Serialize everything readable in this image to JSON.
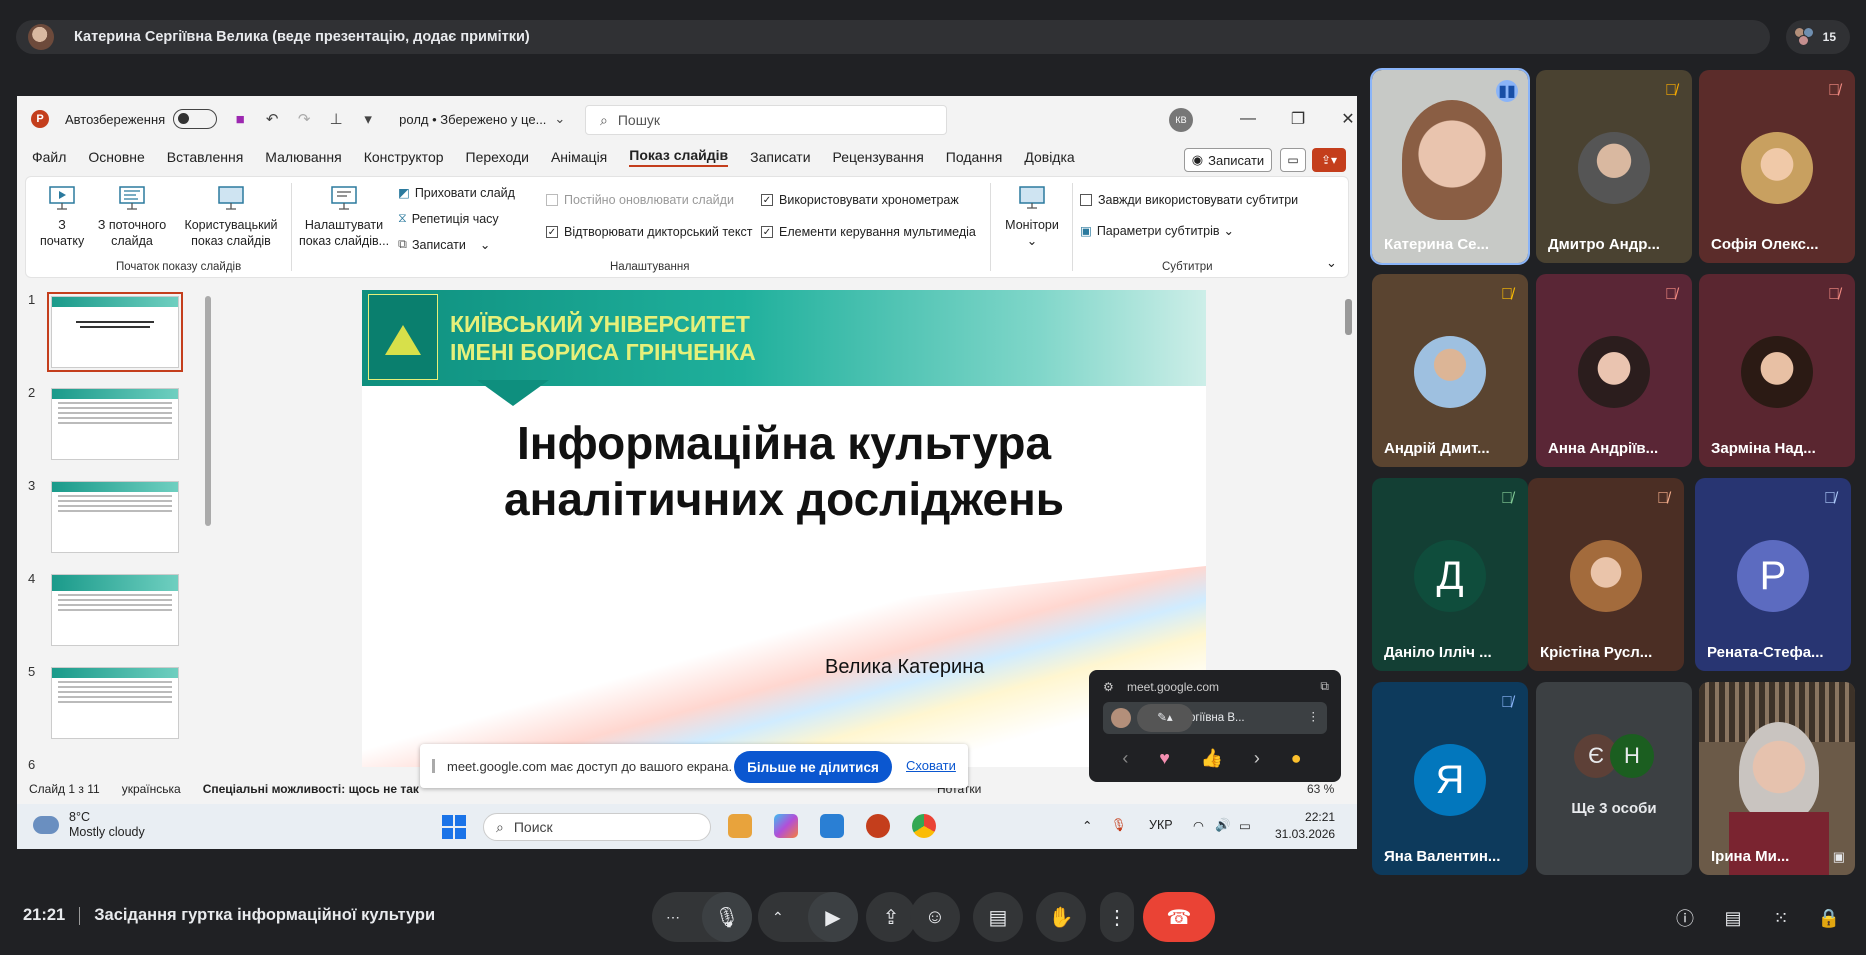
{
  "presenter_banner": {
    "text": "Катерина Сергіївна Велика (веде презентацію, додає примітки)",
    "participant_count": "15"
  },
  "ppt": {
    "autosave_label": "Автозбереження",
    "filename": "ролд • Збережено у це...",
    "search_placeholder": "Пошук",
    "user_initials": "КВ",
    "menu": [
      "Файл",
      "Основне",
      "Вставлення",
      "Малювання",
      "Конструктор",
      "Переходи",
      "Анімація",
      "Показ слайдів",
      "Записати",
      "Рецензування",
      "Подання",
      "Довідка"
    ],
    "record_button": "Записати",
    "ribbon": {
      "from_start": "З\nпочатку",
      "from_current": "З поточного\nслайда",
      "custom_show": "Користувацький\nпоказ слайдів",
      "setup": "Налаштувати\nпоказ слайдів...",
      "hide_slide": "Приховати слайд",
      "rehearse": "Репетиція часу",
      "record": "Записати",
      "keep_updated": "Постійно оновлювати слайди",
      "play_narration": "Відтворювати дикторський текст",
      "use_timings": "Використовувати хронометраж",
      "media_controls": "Елементи керування мультимедіа",
      "monitors": "Монітори",
      "always_subtitles": "Завжди використовувати субтитри",
      "subtitle_settings": "Параметри субтитрів",
      "group_start": "Початок показу слайдів",
      "group_setup": "Налаштування",
      "group_subtitles": "Субтитри"
    },
    "slide_numbers": [
      "1",
      "2",
      "3",
      "4",
      "5",
      "6"
    ],
    "slide": {
      "university": "КИЇВСЬКИЙ УНІВЕРСИТЕТ\nІМЕНІ БОРИСА ГРІНЧЕНКА",
      "title": "Інформаційна культура\nаналітичних досліджень",
      "author": "Велика Катерина"
    },
    "status": {
      "slide_of": "Слайд 1 з 11",
      "language": "українська",
      "accessibility": "Спеціальні можливості: щось не так",
      "notes": "Нотатки",
      "zoom": "63 %"
    }
  },
  "share_notice": {
    "text": "meet.google.com має доступ до вашого екрана.",
    "stop_button": "Більше не ділитися",
    "hide_link": "Сховати"
  },
  "mini_window": {
    "url": "meet.google.com",
    "name": "...ергіївна В..."
  },
  "taskbar": {
    "temperature": "8°C",
    "weather": "Mostly cloudy",
    "search": "Поиск",
    "lang": "УКР",
    "time": "22:21",
    "date": "31.03.2026"
  },
  "participants": [
    {
      "name": "Катерина Се...",
      "speaking": true
    },
    {
      "name": "Дмитро Андр...",
      "muted": true
    },
    {
      "name": "Софія Олекс...",
      "muted": true
    },
    {
      "name": "Андрій Дмит...",
      "muted": true
    },
    {
      "name": "Анна Андріїв...",
      "muted": true
    },
    {
      "name": "Зарміна Над...",
      "muted": true
    },
    {
      "name": "Даніло Ілліч ...",
      "letter": "Д",
      "color": "#0f4d3c"
    },
    {
      "name": "Крістіна Русл...",
      "muted": true
    },
    {
      "name": "Рената-Стефа...",
      "letter": "Р",
      "color": "#5c6bc0"
    },
    {
      "name": "Яна Валентин...",
      "letter": "Я",
      "color": "#0277bd"
    },
    {
      "name": "Ще 3 особи",
      "letters": [
        "Є",
        "Н"
      ]
    },
    {
      "name": "Ірина Ми..."
    }
  ],
  "meeting": {
    "time": "21:21",
    "title": "Засідання гуртка інформаційної культури"
  }
}
